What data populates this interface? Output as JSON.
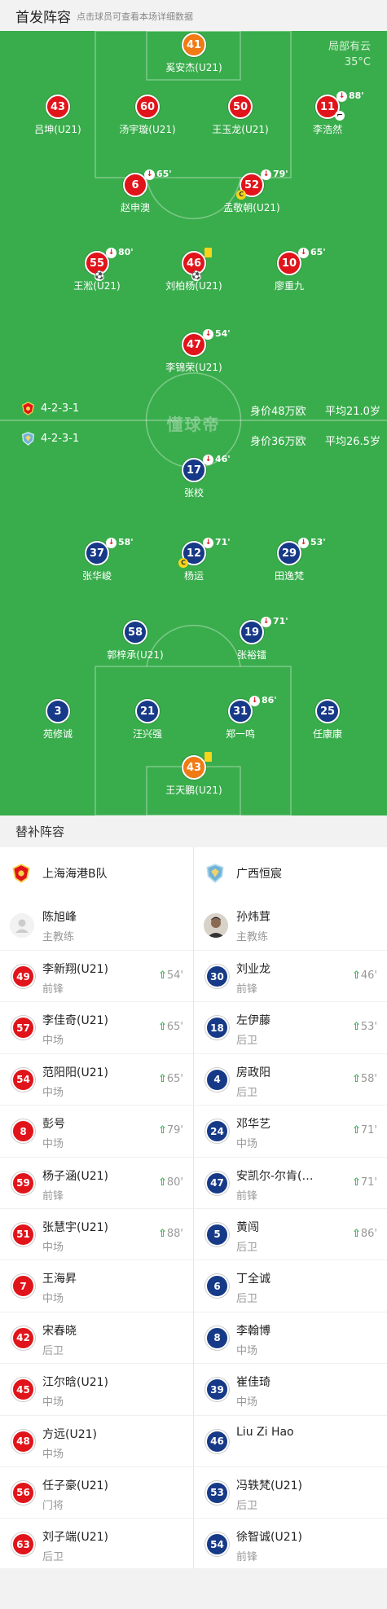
{
  "header": {
    "title": "首发阵容",
    "hint": "点击球员可查看本场详细数据"
  },
  "weather": {
    "condition": "局部有云",
    "temp": "35°C"
  },
  "watermark": "懂球帝",
  "home_team": {
    "name": "上海海港B队",
    "formation": "4-2-3-1",
    "market_value": "身价48万欧",
    "avg_age": "平均21.0岁",
    "color": "#e0141a"
  },
  "away_team": {
    "name": "广西恒宸",
    "formation": "4-2-3-1",
    "market_value": "身价36万欧",
    "avg_age": "平均26.5岁",
    "color": "#173a88"
  },
  "starters": [
    {
      "num": "41",
      "name": "奚安杰(U21)",
      "side": "gk-home"
    },
    {
      "num": "43",
      "name": "吕坤(U21)",
      "side": "home"
    },
    {
      "num": "60",
      "name": "汤宇璇(U21)",
      "side": "home"
    },
    {
      "num": "50",
      "name": "王玉龙(U21)",
      "side": "home"
    },
    {
      "num": "11",
      "name": "李浩然",
      "side": "home",
      "sub": "88'"
    },
    {
      "num": "6",
      "name": "赵申澳",
      "side": "home",
      "sub": "65'"
    },
    {
      "num": "52",
      "name": "孟敬朝(U21)",
      "side": "home",
      "sub": "79'",
      "captain": "C"
    },
    {
      "num": "55",
      "name": "王淞(U21)",
      "side": "home",
      "sub": "80'"
    },
    {
      "num": "46",
      "name": "刘柏杨(U21)",
      "side": "home"
    },
    {
      "num": "10",
      "name": "廖重九",
      "side": "home",
      "sub": "65'"
    },
    {
      "num": "47",
      "name": "李锦荣(U21)",
      "side": "home",
      "sub": "54'"
    },
    {
      "num": "17",
      "name": "张校",
      "side": "away",
      "sub": "46'"
    },
    {
      "num": "37",
      "name": "张华峻",
      "side": "away",
      "sub": "58'"
    },
    {
      "num": "12",
      "name": "杨运",
      "side": "away",
      "sub": "71'",
      "captain": "C"
    },
    {
      "num": "29",
      "name": "田逸梵",
      "side": "away",
      "sub": "53'"
    },
    {
      "num": "58",
      "name": "郭梓承(U21)",
      "side": "away"
    },
    {
      "num": "19",
      "name": "张裕镭",
      "side": "away",
      "sub": "71'"
    },
    {
      "num": "3",
      "name": "苑修诚",
      "side": "away"
    },
    {
      "num": "21",
      "name": "汪兴强",
      "side": "away"
    },
    {
      "num": "31",
      "name": "郑一鸣",
      "side": "away",
      "sub": "86'"
    },
    {
      "num": "25",
      "name": "任康康",
      "side": "away"
    },
    {
      "num": "43",
      "name": "王天鹏(U21)",
      "side": "gk-away"
    }
  ],
  "subs_header": "替补阵容",
  "home_coach": {
    "name": "陈旭峰",
    "role": "主教练"
  },
  "away_coach": {
    "name": "孙炜茸",
    "role": "主教练"
  },
  "home_subs": [
    {
      "num": "49",
      "name": "李新翔(U21)",
      "pos": "前锋",
      "in": "54'"
    },
    {
      "num": "57",
      "name": "李佳奇(U21)",
      "pos": "中场",
      "in": "65'"
    },
    {
      "num": "54",
      "name": "范阳阳(U21)",
      "pos": "中场",
      "in": "65'"
    },
    {
      "num": "8",
      "name": "彭号",
      "pos": "中场",
      "in": "79'"
    },
    {
      "num": "59",
      "name": "杨子涵(U21)",
      "pos": "前锋",
      "in": "80'"
    },
    {
      "num": "51",
      "name": "张慧宇(U21)",
      "pos": "中场",
      "in": "88'"
    },
    {
      "num": "7",
      "name": "王海昇",
      "pos": "中场",
      "in": ""
    },
    {
      "num": "42",
      "name": "宋春晓",
      "pos": "后卫",
      "in": ""
    },
    {
      "num": "45",
      "name": "江尔晗(U21)",
      "pos": "中场",
      "in": ""
    },
    {
      "num": "48",
      "name": "方远(U21)",
      "pos": "中场",
      "in": ""
    },
    {
      "num": "56",
      "name": "任子豪(U21)",
      "pos": "门将",
      "in": ""
    },
    {
      "num": "63",
      "name": "刘子端(U21)",
      "pos": "后卫",
      "in": ""
    }
  ],
  "away_subs": [
    {
      "num": "30",
      "name": "刘业龙",
      "pos": "前锋",
      "in": "46'"
    },
    {
      "num": "18",
      "name": "左伊藤",
      "pos": "后卫",
      "in": "53'"
    },
    {
      "num": "4",
      "name": "房政阳",
      "pos": "后卫",
      "in": "58'"
    },
    {
      "num": "24",
      "name": "邓华艺",
      "pos": "中场",
      "in": "71'"
    },
    {
      "num": "47",
      "name": "安凯尔-尔肯(…",
      "pos": "前锋",
      "in": "71'"
    },
    {
      "num": "5",
      "name": "黄闯",
      "pos": "后卫",
      "in": "86'"
    },
    {
      "num": "6",
      "name": "丁全诚",
      "pos": "后卫",
      "in": ""
    },
    {
      "num": "8",
      "name": "李翰博",
      "pos": "中场",
      "in": ""
    },
    {
      "num": "39",
      "name": "崔佳琦",
      "pos": "中场",
      "in": ""
    },
    {
      "num": "46",
      "name": "Liu Zi Hao",
      "pos": "",
      "in": ""
    },
    {
      "num": "53",
      "name": "冯轶梵(U21)",
      "pos": "后卫",
      "in": ""
    },
    {
      "num": "54",
      "name": "徐智诚(U21)",
      "pos": "前锋",
      "in": ""
    }
  ]
}
